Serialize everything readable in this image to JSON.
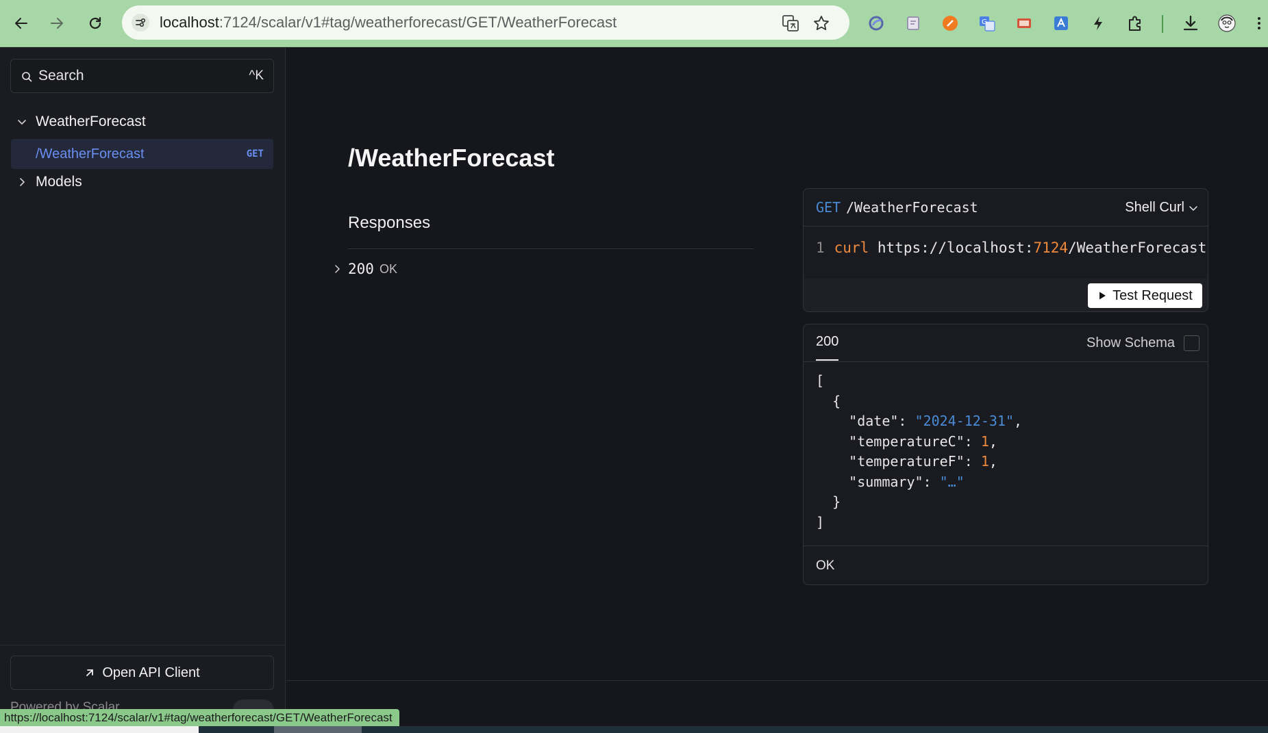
{
  "browser": {
    "url_host": "localhost",
    "url_path": ":7124/scalar/v1#tag/weatherforecast/GET/WeatherForecast",
    "status_url": "https://localhost:7124/scalar/v1#tag/weatherforecast/GET/WeatherForecast"
  },
  "sidebar": {
    "search_label": "Search",
    "search_shortcut": "^K",
    "group_label": "WeatherForecast",
    "active_item_label": "/WeatherForecast",
    "active_item_method": "GET",
    "models_label": "Models",
    "open_client_label": "Open API Client",
    "powered_by": "Powered by Scalar"
  },
  "main": {
    "title": "/WeatherForecast",
    "responses_heading": "Responses",
    "response_code": "200",
    "response_text": "OK"
  },
  "request_card": {
    "method": "GET",
    "path": "/WeatherForecast",
    "language": "Shell Curl",
    "line_number": "1",
    "cmd": "curl",
    "url_prefix": "https://localhost:",
    "url_port": "7124",
    "url_suffix": "/WeatherForecast",
    "test_button": "Test Request"
  },
  "response_card": {
    "tab": "200",
    "show_schema": "Show Schema",
    "json": {
      "open_bracket": "[",
      "open_brace": "{",
      "date_key": "\"date\"",
      "date_val": "\"2024-12-31\"",
      "tempc_key": "\"temperatureC\"",
      "tempc_val": "1",
      "tempf_key": "\"temperatureF\"",
      "tempf_val": "1",
      "summary_key": "\"summary\"",
      "summary_val": "\"…\"",
      "close_brace": "}",
      "close_bracket": "]"
    },
    "footer": "OK"
  },
  "colors": {
    "chrome_bg": "#a7d6a7",
    "page_bg": "#16171c",
    "accent_blue": "#4a8bd6",
    "accent_orange": "#f08a3c"
  }
}
